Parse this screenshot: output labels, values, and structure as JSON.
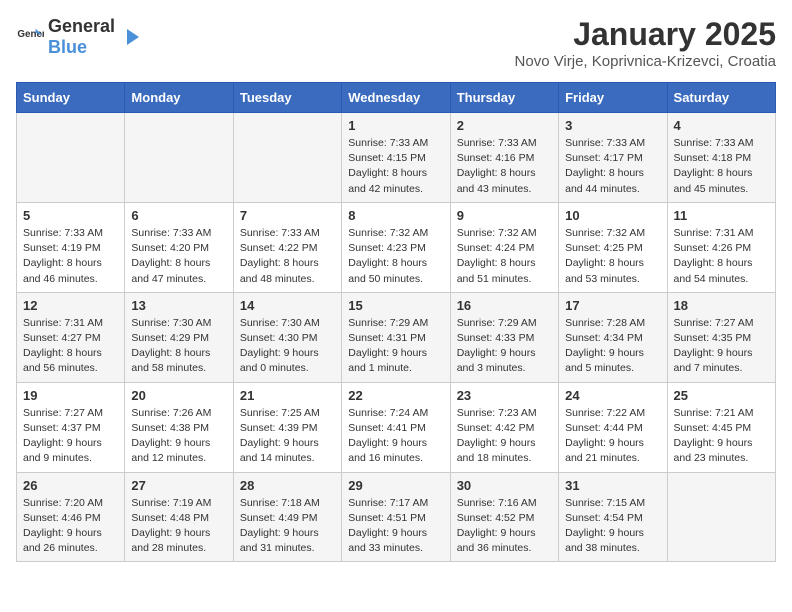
{
  "header": {
    "logo_general": "General",
    "logo_blue": "Blue",
    "title": "January 2025",
    "location": "Novo Virje, Koprivnica-Krizevci, Croatia"
  },
  "days_of_week": [
    "Sunday",
    "Monday",
    "Tuesday",
    "Wednesday",
    "Thursday",
    "Friday",
    "Saturday"
  ],
  "weeks": [
    {
      "days": [
        {
          "number": "",
          "info": ""
        },
        {
          "number": "",
          "info": ""
        },
        {
          "number": "",
          "info": ""
        },
        {
          "number": "1",
          "info": "Sunrise: 7:33 AM\nSunset: 4:15 PM\nDaylight: 8 hours and 42 minutes."
        },
        {
          "number": "2",
          "info": "Sunrise: 7:33 AM\nSunset: 4:16 PM\nDaylight: 8 hours and 43 minutes."
        },
        {
          "number": "3",
          "info": "Sunrise: 7:33 AM\nSunset: 4:17 PM\nDaylight: 8 hours and 44 minutes."
        },
        {
          "number": "4",
          "info": "Sunrise: 7:33 AM\nSunset: 4:18 PM\nDaylight: 8 hours and 45 minutes."
        }
      ]
    },
    {
      "days": [
        {
          "number": "5",
          "info": "Sunrise: 7:33 AM\nSunset: 4:19 PM\nDaylight: 8 hours and 46 minutes."
        },
        {
          "number": "6",
          "info": "Sunrise: 7:33 AM\nSunset: 4:20 PM\nDaylight: 8 hours and 47 minutes."
        },
        {
          "number": "7",
          "info": "Sunrise: 7:33 AM\nSunset: 4:22 PM\nDaylight: 8 hours and 48 minutes."
        },
        {
          "number": "8",
          "info": "Sunrise: 7:32 AM\nSunset: 4:23 PM\nDaylight: 8 hours and 50 minutes."
        },
        {
          "number": "9",
          "info": "Sunrise: 7:32 AM\nSunset: 4:24 PM\nDaylight: 8 hours and 51 minutes."
        },
        {
          "number": "10",
          "info": "Sunrise: 7:32 AM\nSunset: 4:25 PM\nDaylight: 8 hours and 53 minutes."
        },
        {
          "number": "11",
          "info": "Sunrise: 7:31 AM\nSunset: 4:26 PM\nDaylight: 8 hours and 54 minutes."
        }
      ]
    },
    {
      "days": [
        {
          "number": "12",
          "info": "Sunrise: 7:31 AM\nSunset: 4:27 PM\nDaylight: 8 hours and 56 minutes."
        },
        {
          "number": "13",
          "info": "Sunrise: 7:30 AM\nSunset: 4:29 PM\nDaylight: 8 hours and 58 minutes."
        },
        {
          "number": "14",
          "info": "Sunrise: 7:30 AM\nSunset: 4:30 PM\nDaylight: 9 hours and 0 minutes."
        },
        {
          "number": "15",
          "info": "Sunrise: 7:29 AM\nSunset: 4:31 PM\nDaylight: 9 hours and 1 minute."
        },
        {
          "number": "16",
          "info": "Sunrise: 7:29 AM\nSunset: 4:33 PM\nDaylight: 9 hours and 3 minutes."
        },
        {
          "number": "17",
          "info": "Sunrise: 7:28 AM\nSunset: 4:34 PM\nDaylight: 9 hours and 5 minutes."
        },
        {
          "number": "18",
          "info": "Sunrise: 7:27 AM\nSunset: 4:35 PM\nDaylight: 9 hours and 7 minutes."
        }
      ]
    },
    {
      "days": [
        {
          "number": "19",
          "info": "Sunrise: 7:27 AM\nSunset: 4:37 PM\nDaylight: 9 hours and 9 minutes."
        },
        {
          "number": "20",
          "info": "Sunrise: 7:26 AM\nSunset: 4:38 PM\nDaylight: 9 hours and 12 minutes."
        },
        {
          "number": "21",
          "info": "Sunrise: 7:25 AM\nSunset: 4:39 PM\nDaylight: 9 hours and 14 minutes."
        },
        {
          "number": "22",
          "info": "Sunrise: 7:24 AM\nSunset: 4:41 PM\nDaylight: 9 hours and 16 minutes."
        },
        {
          "number": "23",
          "info": "Sunrise: 7:23 AM\nSunset: 4:42 PM\nDaylight: 9 hours and 18 minutes."
        },
        {
          "number": "24",
          "info": "Sunrise: 7:22 AM\nSunset: 4:44 PM\nDaylight: 9 hours and 21 minutes."
        },
        {
          "number": "25",
          "info": "Sunrise: 7:21 AM\nSunset: 4:45 PM\nDaylight: 9 hours and 23 minutes."
        }
      ]
    },
    {
      "days": [
        {
          "number": "26",
          "info": "Sunrise: 7:20 AM\nSunset: 4:46 PM\nDaylight: 9 hours and 26 minutes."
        },
        {
          "number": "27",
          "info": "Sunrise: 7:19 AM\nSunset: 4:48 PM\nDaylight: 9 hours and 28 minutes."
        },
        {
          "number": "28",
          "info": "Sunrise: 7:18 AM\nSunset: 4:49 PM\nDaylight: 9 hours and 31 minutes."
        },
        {
          "number": "29",
          "info": "Sunrise: 7:17 AM\nSunset: 4:51 PM\nDaylight: 9 hours and 33 minutes."
        },
        {
          "number": "30",
          "info": "Sunrise: 7:16 AM\nSunset: 4:52 PM\nDaylight: 9 hours and 36 minutes."
        },
        {
          "number": "31",
          "info": "Sunrise: 7:15 AM\nSunset: 4:54 PM\nDaylight: 9 hours and 38 minutes."
        },
        {
          "number": "",
          "info": ""
        }
      ]
    }
  ]
}
